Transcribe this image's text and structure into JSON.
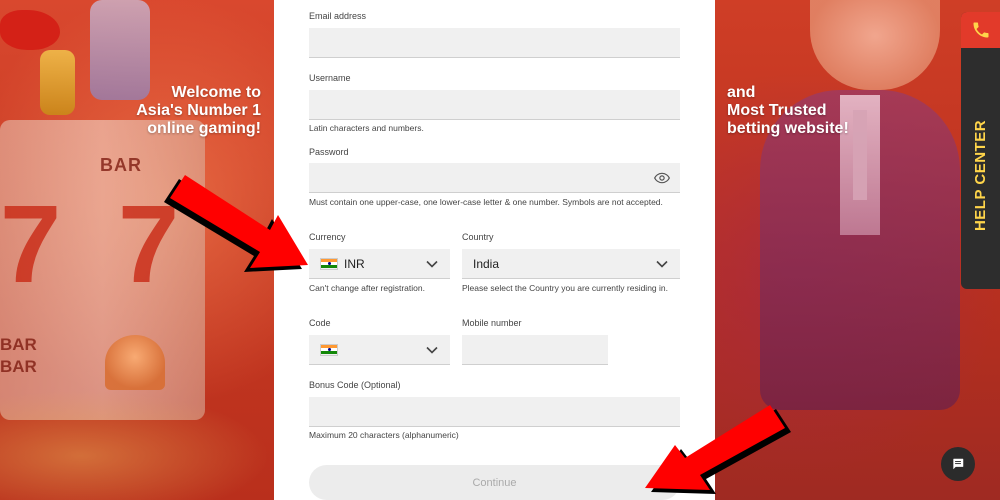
{
  "promo": {
    "left_lines": [
      "Welcome to",
      "Asia's Number 1",
      "online gaming!"
    ],
    "right_lines": [
      "and",
      "Most Trusted",
      "betting website!"
    ]
  },
  "decor": {
    "reel_bar_top": "BAR",
    "reel_seven": "7",
    "reel_bar_bottom": "BAR"
  },
  "form": {
    "email": {
      "label": "Email address",
      "value": ""
    },
    "username": {
      "label": "Username",
      "value": "",
      "hint": "Latin characters and numbers."
    },
    "password": {
      "label": "Password",
      "value": "",
      "hint": "Must contain one upper-case, one lower-case letter & one number. Symbols are not accepted."
    },
    "currency": {
      "label": "Currency",
      "value": "INR",
      "hint": "Can't change after registration."
    },
    "country": {
      "label": "Country",
      "value": "India",
      "hint": "Please select the Country you are currently residing in."
    },
    "code": {
      "label": "Code",
      "value": ""
    },
    "mobile": {
      "label": "Mobile number",
      "value": ""
    },
    "bonus": {
      "label": "Bonus Code (Optional)",
      "value": "",
      "hint": "Maximum 20 characters (alphanumeric)"
    },
    "continue_label": "Continue"
  },
  "help_center": {
    "label": "HELP CENTER",
    "icon": "phone-icon"
  },
  "chat": {
    "icon": "chat-icon"
  },
  "colors": {
    "accent_red": "#e23a2a",
    "help_yellow": "#ffd54a",
    "help_bg": "#2d2d2d",
    "field_bg": "#f0f0f0",
    "arrow_red": "#ff0000"
  }
}
